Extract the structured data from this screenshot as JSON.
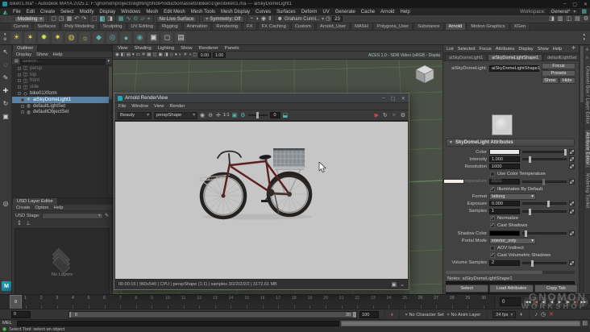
{
  "window": {
    "title": "bike01.ma* - Autodesk MAYA 2025.1: F:\\gnomon\\projects\\lightingShotProduction\\assets\\Bike01\\ges\\bike01.ma --- aiSkyDomeLight1",
    "minimize": "–",
    "maximize": "▢",
    "close": "✕"
  },
  "menubar": {
    "items": [
      "File",
      "Edit",
      "Create",
      "Select",
      "Modify",
      "Display",
      "Windows",
      "Mesh",
      "Edit Mesh",
      "Mesh Tools",
      "Mesh Display",
      "Curves",
      "Surfaces",
      "Deform",
      "UV",
      "Generate",
      "Cache",
      "Arnold",
      "Help"
    ],
    "workspace_label": "Workspace:",
    "workspace_value": "General*"
  },
  "statusline": {
    "mode": "Modeling",
    "file_icons": [
      [
        "new-scene-icon",
        "▢"
      ],
      [
        "open-scene-icon",
        "◳"
      ],
      [
        "save-scene-icon",
        "▦"
      ],
      [
        "undo-icon",
        "↶"
      ],
      [
        "redo-icon",
        "↷"
      ]
    ],
    "select_icons": [
      [
        "select-hierarchy-icon",
        "⬚",
        false
      ],
      [
        "select-object-icon",
        "◧",
        true
      ],
      [
        "select-component-icon",
        "◨",
        false
      ]
    ],
    "snap_icons": [
      [
        "snap-grid-icon",
        "▦"
      ],
      [
        "snap-curve-icon",
        "∿"
      ],
      [
        "snap-point-icon",
        "⊙"
      ],
      [
        "snap-plane-icon",
        "▱"
      ],
      [
        "make-live-icon",
        "⌖"
      ]
    ],
    "no_live_surface": "No Live Surface",
    "symmetry": "Symmetry: Off",
    "history_icons": [
      [
        "construction-history-icon",
        "◔"
      ],
      [
        "render-current-frame-icon",
        "◑"
      ],
      [
        "ipr-render-icon",
        "◉"
      ],
      [
        "pause-icon",
        "Ⅱ"
      ]
    ],
    "user": "Graham Cunni...",
    "timer_badge": "23",
    "right_icons": [
      [
        "single-pane-toggle-icon",
        "◨"
      ],
      [
        "channel-box-toggle-icon",
        "▥"
      ],
      [
        "attribute-editor-toggle-icon",
        "◫"
      ],
      [
        "tool-settings-toggle-icon",
        "▤"
      ],
      [
        "workspace-settings-icon",
        "⚙"
      ]
    ]
  },
  "shelf": {
    "tabs": [
      "Curves",
      "Surfaces",
      "Poly Modeling",
      "Sculpting",
      "UV Editing",
      "Rigging",
      "Animation",
      "Rendering",
      "FX",
      "FX Caching",
      "Custom",
      "Arnold_User",
      "MASH",
      "Polygons_User",
      "Substance",
      "Arnold",
      "Motion Graphics",
      "XGen"
    ],
    "active_tab": "Arnold",
    "icons": [
      [
        "skydome-light-icon",
        "☀",
        "#e8d44f"
      ],
      [
        "area-light-icon",
        "✶",
        "#e8d44f"
      ],
      [
        "mesh-light-icon",
        "✹",
        "#cfe04f"
      ],
      [
        "photometric-light-icon",
        "✷",
        "#e8d44f"
      ],
      [
        "light-portal-icon",
        "◍",
        "#d8c84f"
      ],
      [
        "physical-sky-icon",
        "☼",
        "#e0c84a"
      ],
      [
        "standin-icon",
        "◆",
        "#56b8b0"
      ],
      [
        "gpu-cache-icon",
        "◎",
        "#56b8b0"
      ],
      [
        "volume-icon",
        "●",
        "#56b8b0"
      ],
      [
        "curve-collector-icon",
        "◉",
        "#4fa8a0"
      ],
      [
        "render-icon",
        "▣",
        "#cfd0d0"
      ],
      [
        "ipr-render-icon",
        "◻",
        "#cfd0d0"
      ],
      [
        "render-settings-icon",
        "▤",
        "#cfd0d0"
      ]
    ]
  },
  "toolbox": {
    "tools": [
      [
        "select-tool-icon",
        "↖"
      ],
      [
        "lasso-tool-icon",
        "◌"
      ],
      [
        "paint-select-tool-icon",
        "✎"
      ],
      [
        "move-tool-icon",
        "✚"
      ],
      [
        "rotate-tool-icon",
        "↻"
      ],
      [
        "scale-tool-icon",
        "▣"
      ],
      [
        "zoom-tool-icon",
        "◎"
      ]
    ]
  },
  "outliner": {
    "tab": "Outliner",
    "menu": [
      "Display",
      "Show",
      "Help"
    ],
    "search_placeholder": "Search...",
    "items": [
      {
        "label": "persp",
        "icon": "camera-icon",
        "glyph": "◫",
        "color": "#8a8a8a",
        "dim": true
      },
      {
        "label": "top",
        "icon": "camera-icon",
        "glyph": "◫",
        "color": "#8a8a8a",
        "dim": true
      },
      {
        "label": "front",
        "icon": "camera-icon",
        "glyph": "◫",
        "color": "#8a8a8a",
        "dim": true
      },
      {
        "label": "side",
        "icon": "camera-icon",
        "glyph": "◫",
        "color": "#8a8a8a",
        "dim": true
      },
      {
        "label": "bike01Xform",
        "icon": "transform-icon",
        "glyph": "◇",
        "color": "#b8b8b8",
        "dim": false
      },
      {
        "label": "aiSkyDomeLight1",
        "icon": "skydome-light-icon",
        "glyph": "☀",
        "color": "#e4d98a",
        "dim": false,
        "selected": true
      },
      {
        "label": "defaultLightSet",
        "icon": "set-icon",
        "glyph": "◍",
        "color": "#9fae9f",
        "dim": false
      },
      {
        "label": "defaultObjectSet",
        "icon": "set-icon",
        "glyph": "◍",
        "color": "#9fae9f",
        "dim": false
      }
    ]
  },
  "usd": {
    "tab": "USD Layer Editor",
    "menu": [
      "Create",
      "Option",
      "Help"
    ],
    "stage_label": "USD Stage:",
    "icons": [
      [
        "load-layer-icon",
        "↧"
      ],
      [
        "pin-stage-icon",
        "⊥"
      ]
    ],
    "empty_text": "No Layers"
  },
  "viewport": {
    "menu": [
      "View",
      "Shading",
      "Lighting",
      "Show",
      "Renderer",
      "Panels"
    ],
    "icons": [
      [
        "select-camera-icon",
        "◉"
      ],
      [
        "lock-camera-icon",
        "◧"
      ],
      [
        "camera-attributes-icon",
        "▤"
      ],
      [
        "bookmark-icon",
        "▾"
      ],
      [
        "image-plane-icon",
        "▭"
      ],
      [
        "two-d-pan-zoom-icon",
        "✛"
      ],
      [
        "grid-icon",
        "▦"
      ],
      [
        "film-gate-icon",
        "◫"
      ],
      [
        "resolution-gate-icon",
        "▣"
      ],
      [
        "gate-mask-icon",
        "◨"
      ],
      [
        "wireframe-icon",
        "◇"
      ],
      [
        "shaded-icon",
        "●"
      ],
      [
        "textured-icon",
        "◐"
      ],
      [
        "lights-icon",
        "☀"
      ],
      [
        "shadows-icon",
        "◑"
      ],
      [
        "xray-icon",
        "◻"
      ]
    ],
    "exposure": "0.00",
    "gamma": "1.00",
    "colorspace": "ACES 1.0 - SDR Video (sRGB - Displa"
  },
  "renderview": {
    "title": "Arnold RenderView",
    "menu": [
      "File",
      "Window",
      "View",
      "Render"
    ],
    "aov": "Beauty",
    "camera": "perspShape",
    "left_icons": [
      [
        "snapshot-icon",
        "◉"
      ],
      [
        "isolate-selected-icon",
        "⊖"
      ],
      [
        "region-crop-icon",
        "✛"
      ]
    ],
    "zoom_level": "1:1",
    "mid_icons": [
      [
        "lock-resolution-icon",
        "▣"
      ],
      [
        "debug-shading-icon",
        "⚙"
      ]
    ],
    "debug_value": "0",
    "save_icon": [
      "save-image-icon",
      "⬓"
    ],
    "right_icons": [
      [
        "start-render-icon",
        "▶"
      ],
      [
        "refresh-render-icon",
        "↻"
      ],
      [
        "abort-render-icon",
        "✕"
      ],
      [
        "renderview-settings-icon",
        "⚙"
      ]
    ],
    "status": "00:00:16 | 960x540 | CPU | perspShape (1:1) | samples 3/2/2/2/2/2 | 3172.61 MB",
    "status_icons": [
      [
        "aov-display-icon",
        "▣"
      ],
      [
        "expand-status-icon",
        "⌄"
      ]
    ]
  },
  "attribute_editor": {
    "menu": [
      "List",
      "Selected",
      "Focus",
      "Attributes",
      "Display",
      "Show",
      "Help"
    ],
    "tabs": [
      "aiSkyDomeLight1",
      "aiSkyDomeLightShape1",
      "defaultLightSet"
    ],
    "active_tab": "aiSkyDomeLightShape1",
    "name_label": "aiSkyDomeLight:",
    "name_value": "aiSkyDomeLightShape1",
    "focus_button": "Focus",
    "presets_button": "Presets",
    "show_button": "Show",
    "hide_button": "Hide",
    "section": "SkyDomeLight Attributes",
    "rows": [
      {
        "type": "color",
        "label": "Color",
        "swatch": "#e9e9e9",
        "slider": 0.97
      },
      {
        "type": "number",
        "label": "Intensity",
        "value": "1.000",
        "slider": 0.14
      },
      {
        "type": "field",
        "label": "Resolution",
        "value": "1000"
      },
      {
        "type": "checkbox",
        "label": "Use Color Temperature",
        "checked": false
      },
      {
        "type": "number",
        "label": "Temperature",
        "value": "6500",
        "slider": 0.45,
        "disabled": true,
        "left_swatch": "#f3efe6"
      },
      {
        "type": "checkbox",
        "label": "Illuminates By Default",
        "checked": true
      },
      {
        "type": "dropdown",
        "label": "Format",
        "value": "latlong"
      },
      {
        "type": "number",
        "label": "Exposure",
        "value": "0.000",
        "slider": 0.57
      },
      {
        "type": "number",
        "label": "Samples",
        "value": "1",
        "slider": 0.14
      },
      {
        "type": "checkbox",
        "label": "Normalize",
        "checked": true
      },
      {
        "type": "checkbox",
        "label": "Cast Shadows",
        "checked": true
      },
      {
        "type": "color",
        "label": "Shadow Color",
        "swatch": "#000000",
        "slider": 0.03
      },
      {
        "type": "dropdown",
        "label": "Portal Mode",
        "value": "interior_only"
      },
      {
        "type": "checkbox",
        "label": "AOV Indirect",
        "checked": false
      },
      {
        "type": "checkbox",
        "label": "Cast Volumetric Shadows",
        "checked": true
      },
      {
        "type": "number",
        "label": "Volume Samples",
        "value": "2",
        "slider": 0.18
      }
    ],
    "notes_label": "Notes: aiSkyDomeLightShape1",
    "buttons": [
      "Select",
      "Load Attributes",
      "Copy Tab"
    ]
  },
  "right_strip": {
    "icons": [
      [
        "pin-icon",
        "✛"
      ],
      [
        "collapse-icon",
        "≡"
      ]
    ],
    "tabs": [
      "Channel Box / Layer Editor",
      "Attribute Editor",
      "Modeling Toolkit"
    ],
    "active": "Attribute Editor"
  },
  "timeline": {
    "ticks": [
      1,
      2,
      3,
      4,
      5,
      6,
      7,
      8,
      9,
      10,
      11,
      12,
      13,
      14,
      15,
      16,
      17,
      18,
      19,
      20,
      21,
      22,
      23,
      24,
      25,
      26,
      27,
      28,
      29,
      30
    ],
    "current_frame": "0",
    "current_frame_field": "0"
  },
  "playback": {
    "buttons": [
      {
        "name": "go-to-start-button",
        "glyph": "|◀◀",
        "red": false
      },
      {
        "name": "step-back-key-button",
        "glyph": "|◀",
        "red": true
      },
      {
        "name": "step-back-frame-button",
        "glyph": "◀|",
        "red": false
      },
      {
        "name": "play-backwards-button",
        "glyph": "◀",
        "red": false
      },
      {
        "name": "play-forwards-button",
        "glyph": "▶",
        "red": false
      },
      {
        "name": "step-forward-frame-button",
        "glyph": "|▶",
        "red": false
      },
      {
        "name": "step-forward-key-button",
        "glyph": "▶|",
        "red": true
      },
      {
        "name": "go-to-end-button",
        "glyph": "▶▶|",
        "red": false
      }
    ]
  },
  "range_slider": {
    "start": "0",
    "range_start": "0",
    "range_end": "30",
    "end": "100",
    "character_set": "No Character Set",
    "anim_layer": "No Anim Layer",
    "fps": "24 fps"
  },
  "command_line": {
    "label": "MEL"
  },
  "help_line": {
    "text": "Select Tool: select an object"
  },
  "watermark": {
    "line1": "GNOMON",
    "line2": "WORKSHOP"
  },
  "colors": {
    "accent_teal": "#56b8b0",
    "selection_blue": "#5a82a6",
    "light_yellow": "#e8d44f",
    "record_red": "#d04545"
  }
}
